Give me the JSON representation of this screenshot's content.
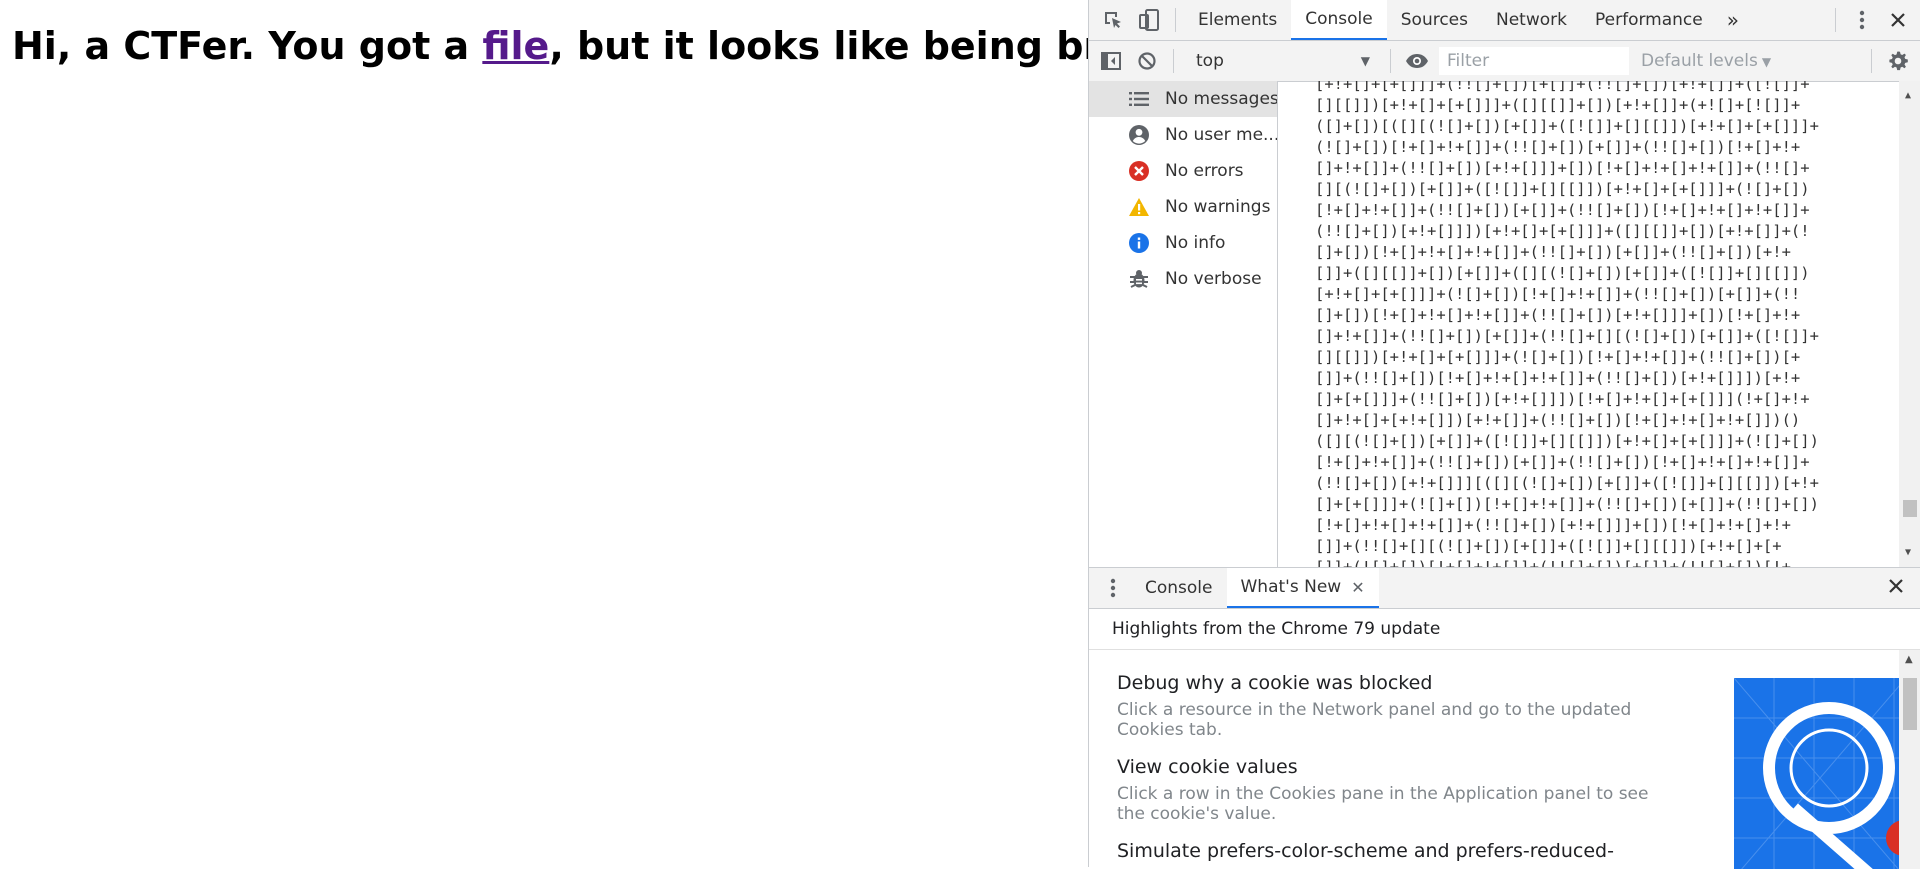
{
  "page": {
    "heading_before": "Hi, a CTFer. You got a ",
    "heading_link": "file",
    "heading_after": ", but it looks like being broken."
  },
  "devtools": {
    "tabs": [
      "Elements",
      "Console",
      "Sources",
      "Network",
      "Performance"
    ],
    "active_tab": "Console",
    "more_tabs": "»",
    "console_bar": {
      "context": "top",
      "filter_placeholder": "Filter",
      "levels": "Default levels"
    },
    "sidebar": [
      {
        "label": "No messages",
        "icon": "list-icon"
      },
      {
        "label": "No user me...",
        "icon": "user-icon"
      },
      {
        "label": "No errors",
        "icon": "error-icon"
      },
      {
        "label": "No warnings",
        "icon": "warning-icon"
      },
      {
        "label": "No info",
        "icon": "info-icon"
      },
      {
        "label": "No verbose",
        "icon": "bug-icon"
      }
    ],
    "console_lines": [
      "[+!+[]+[+[]]]+(!![]+[])[+[]]+(!![]+[])[+!+[]]+([![]]+",
      "[][[]])[+!+[]+[+[]]]+([][[]]+[])[+!+[]]+(+![]+[![]]+",
      "([]+[])[([][(![]+[])[+[]]+([![]]+[][[]])[+!+[]+[+[]]]+",
      "(![]+[])[!+[]+!+[]]+(!![]+[])[+[]]+(!![]+[])[!+[]+!+",
      "[]+!+[]]+(!![]+[])[+!+[]]]+[])[!+[]+!+[]+!+[]]+(!![]+",
      "[][(![]+[])[+[]]+([![]]+[][[]])[+!+[]+[+[]]]+(![]+[])",
      "[!+[]+!+[]]+(!![]+[])[+[]]+(!![]+[])[!+[]+!+[]+!+[]]+",
      "(!![]+[])[+!+[]]])[+!+[]+[+[]]]+([][[]]+[])[+!+[]]+(!",
      "[]+[])[!+[]+!+[]+!+[]]+(!![]+[])[+[]]+(!![]+[])[+!+",
      "[]]+([][[]]+[])[+[]]+([][(![]+[])[+[]]+([![]]+[][[]])",
      "[+!+[]+[+[]]]+(![]+[])[!+[]+!+[]]+(!![]+[])[+[]]+(!!",
      "[]+[])[!+[]+!+[]+!+[]]+(!![]+[])[+!+[]]]+[])[!+[]+!+",
      "[]+!+[]]+(!![]+[])[+[]]+(!![]+[][(![]+[])[+[]]+([![]]+",
      "[][[]])[+!+[]+[+[]]]+(![]+[])[!+[]+!+[]]+(!![]+[])[+",
      "[]]+(!![]+[])[!+[]+!+[]+!+[]]+(!![]+[])[+!+[]]])[+!+",
      "[]+[+[]]]+(!![]+[])[+!+[]]])[!+[]+!+[]+[+[]]](!+[]+!+",
      "[]+!+[]+[+!+[]])[+!+[]]+(!![]+[])[!+[]+!+[]+!+[]])()",
      "([][(![]+[])[+[]]+([![]]+[][[]])[+!+[]+[+[]]]+(![]+[])",
      "[!+[]+!+[]]+(!![]+[])[+[]]+(!![]+[])[!+[]+!+[]+!+[]]+",
      "(!![]+[])[+!+[]]][([][(![]+[])[+[]]+([![]]+[][[]])[+!+",
      "[]+[+[]]]+(![]+[])[!+[]+!+[]]+(!![]+[])[+[]]+(!![]+[])",
      "[!+[]+!+[]+!+[]]+(!![]+[])[+!+[]]]+[])[!+[]+!+[]+!+",
      "[]]+(!![]+[][(![]+[])[+[]]+([![]]+[][[]])[+!+[]+[+",
      "[]]+(![]+[])[!+[]+!+[]]+(!![]+[])[+[]]+(!![]+[])[!+"
    ],
    "drawer": {
      "tabs": [
        "Console",
        "What's New"
      ],
      "active_tab": "What's New",
      "header": "Highlights from the Chrome 79 update",
      "items": [
        {
          "title": "Debug why a cookie was blocked",
          "desc": "Click a resource in the Network panel and go to the updated Cookies tab."
        },
        {
          "title": "View cookie values",
          "desc": "Click a row in the Cookies pane in the Application panel to see the cookie's value."
        },
        {
          "title": "Simulate prefers-color-scheme and prefers-reduced-",
          "desc": ""
        }
      ]
    },
    "colors": {
      "accent": "#1a73e8",
      "error": "#d93025",
      "warning": "#f2b600",
      "info": "#1a73e8",
      "link_visited": "#551a8b"
    }
  }
}
